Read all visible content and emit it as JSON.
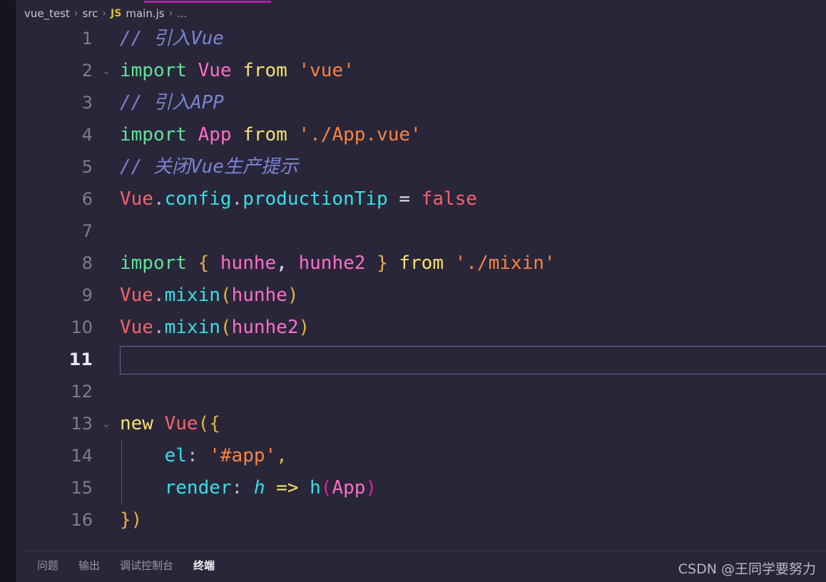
{
  "window": {
    "theme_background": "#292639",
    "activity_bar_color": "#17141f",
    "active_tab_underline_color": "#a626a4"
  },
  "breadcrumb": {
    "segments": [
      {
        "label": "vue_test",
        "kind": "folder"
      },
      {
        "label": "src",
        "kind": "folder"
      },
      {
        "label": "main.js",
        "kind": "file",
        "badge": "JS"
      }
    ],
    "separator": "›",
    "trailing": "..."
  },
  "editor": {
    "language_badge": "JS",
    "file_name": "main.js",
    "active_line_number": 11,
    "total_lines": 16,
    "lines": [
      {
        "number": "1",
        "fold": "",
        "tokens": [
          {
            "text": "// 引入Vue",
            "cls": "t-comment"
          }
        ]
      },
      {
        "number": "2",
        "fold": "⌄",
        "tokens": [
          {
            "text": "import ",
            "cls": "t-keyword"
          },
          {
            "text": "Vue ",
            "cls": "t-ident"
          },
          {
            "text": "from ",
            "cls": "t-from"
          },
          {
            "text": "'vue'",
            "cls": "t-string"
          }
        ]
      },
      {
        "number": "3",
        "fold": "",
        "tokens": [
          {
            "text": "// 引入APP",
            "cls": "t-comment"
          }
        ]
      },
      {
        "number": "4",
        "fold": "",
        "tokens": [
          {
            "text": "import ",
            "cls": "t-keyword"
          },
          {
            "text": "App ",
            "cls": "t-ident"
          },
          {
            "text": "from ",
            "cls": "t-from"
          },
          {
            "text": "'./App.vue'",
            "cls": "t-string"
          }
        ]
      },
      {
        "number": "5",
        "fold": "",
        "tokens": [
          {
            "text": "// 关闭Vue生产提示",
            "cls": "t-comment"
          }
        ]
      },
      {
        "number": "6",
        "fold": "",
        "tokens": [
          {
            "text": "Vue",
            "cls": "t-object"
          },
          {
            "text": ".",
            "cls": "t-dot"
          },
          {
            "text": "config",
            "cls": "t-prop"
          },
          {
            "text": ".",
            "cls": "t-dot"
          },
          {
            "text": "productionTip ",
            "cls": "t-prop"
          },
          {
            "text": "= ",
            "cls": "t-punct"
          },
          {
            "text": "false",
            "cls": "t-object"
          }
        ]
      },
      {
        "number": "7",
        "fold": "",
        "tokens": []
      },
      {
        "number": "8",
        "fold": "",
        "tokens": [
          {
            "text": "import ",
            "cls": "t-keyword"
          },
          {
            "text": "{ ",
            "cls": "t-brace"
          },
          {
            "text": "hunhe",
            "cls": "t-ident"
          },
          {
            "text": ", ",
            "cls": "t-punct"
          },
          {
            "text": "hunhe2 ",
            "cls": "t-ident"
          },
          {
            "text": "} ",
            "cls": "t-brace"
          },
          {
            "text": "from ",
            "cls": "t-from"
          },
          {
            "text": "'./mixin'",
            "cls": "t-string"
          }
        ]
      },
      {
        "number": "9",
        "fold": "",
        "tokens": [
          {
            "text": "Vue",
            "cls": "t-object"
          },
          {
            "text": ".",
            "cls": "t-dot"
          },
          {
            "text": "mixin",
            "cls": "t-prop"
          },
          {
            "text": "(",
            "cls": "t-paren-y"
          },
          {
            "text": "hunhe",
            "cls": "t-ident"
          },
          {
            "text": ")",
            "cls": "t-paren-y"
          }
        ]
      },
      {
        "number": "10",
        "fold": "",
        "tokens": [
          {
            "text": "Vue",
            "cls": "t-object"
          },
          {
            "text": ".",
            "cls": "t-dot"
          },
          {
            "text": "mixin",
            "cls": "t-prop"
          },
          {
            "text": "(",
            "cls": "t-paren-y"
          },
          {
            "text": "hunhe2",
            "cls": "t-ident"
          },
          {
            "text": ")",
            "cls": "t-paren-y"
          }
        ]
      },
      {
        "number": "11",
        "fold": "",
        "tokens": [],
        "active": true
      },
      {
        "number": "12",
        "fold": "",
        "tokens": []
      },
      {
        "number": "13",
        "fold": "⌄",
        "tokens": [
          {
            "text": "new ",
            "cls": "t-from"
          },
          {
            "text": "Vue",
            "cls": "t-object"
          },
          {
            "text": "(",
            "cls": "t-paren-y"
          },
          {
            "text": "{",
            "cls": "t-brace"
          }
        ]
      },
      {
        "number": "14",
        "fold": "",
        "indent_guide": true,
        "tokens": [
          {
            "text": "    ",
            "cls": "t-punct"
          },
          {
            "text": "el",
            "cls": "t-prop"
          },
          {
            "text": ": ",
            "cls": "t-dot"
          },
          {
            "text": "'#app'",
            "cls": "t-string"
          },
          {
            "text": ",",
            "cls": "t-brace"
          }
        ]
      },
      {
        "number": "15",
        "fold": "",
        "indent_guide": true,
        "tokens": [
          {
            "text": "    ",
            "cls": "t-punct"
          },
          {
            "text": "render",
            "cls": "t-prop"
          },
          {
            "text": ": ",
            "cls": "t-dot"
          },
          {
            "text": "h",
            "cls": "t-prop t-italic"
          },
          {
            "text": " => ",
            "cls": "t-from"
          },
          {
            "text": "h",
            "cls": "t-prop"
          },
          {
            "text": "(",
            "cls": "t-paren-m"
          },
          {
            "text": "App",
            "cls": "t-ident"
          },
          {
            "text": ")",
            "cls": "t-paren-m"
          }
        ]
      },
      {
        "number": "16",
        "fold": "",
        "tokens": [
          {
            "text": "}",
            "cls": "t-brace"
          },
          {
            "text": ")",
            "cls": "t-paren-y"
          }
        ]
      }
    ]
  },
  "panel": {
    "tabs": [
      {
        "label": "问题",
        "active": false
      },
      {
        "label": "输出",
        "active": false
      },
      {
        "label": "调试控制台",
        "active": false
      },
      {
        "label": "终端",
        "active": true
      }
    ]
  },
  "watermark": {
    "text": "CSDN @王同学要努力"
  }
}
